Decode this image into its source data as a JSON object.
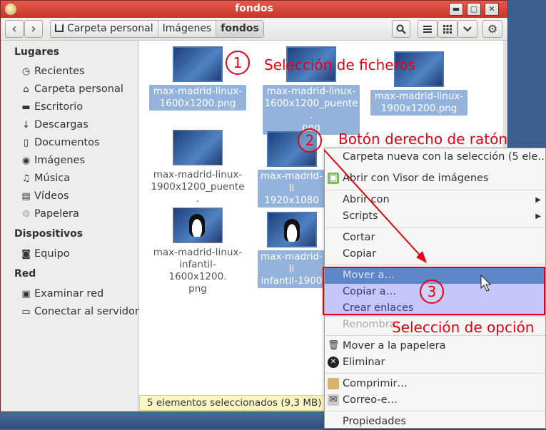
{
  "window": {
    "title": "fondos"
  },
  "titlebar": {
    "minimize": "▬",
    "maximize": "▢",
    "close": "✕"
  },
  "toolbar": {
    "back": "‹",
    "forward": "›",
    "breadcrumbs": [
      "Carpeta personal",
      "Imágenes",
      "fondos"
    ],
    "search_icon": "search-icon",
    "menu_icon": "list-icon",
    "grid_icon": "grid-icon",
    "chevron": "⌄",
    "gear": "⚙"
  },
  "sidebar": {
    "places_header": "Lugares",
    "places": [
      {
        "label": "Recientes",
        "icon": "◷"
      },
      {
        "label": "Carpeta personal",
        "icon": "⌂"
      },
      {
        "label": "Escritorio",
        "icon": "▬"
      },
      {
        "label": "Descargas",
        "icon": "↓"
      },
      {
        "label": "Documentos",
        "icon": "▯"
      },
      {
        "label": "Imágenes",
        "icon": "◉"
      },
      {
        "label": "Música",
        "icon": "♫"
      },
      {
        "label": "Vídeos",
        "icon": "▤"
      },
      {
        "label": "Papelera",
        "icon": "♲"
      }
    ],
    "devices_header": "Dispositivos",
    "devices": [
      {
        "label": "Equipo",
        "icon": "◙"
      }
    ],
    "network_header": "Red",
    "network": [
      {
        "label": "Examinar red",
        "icon": "▣"
      },
      {
        "label": "Conectar al servidor",
        "icon": "▭"
      }
    ]
  },
  "files": [
    {
      "name": "max-madrid-linux-1600x1200.png",
      "selected": true
    },
    {
      "name": "max-madrid-linux-1600x1200_puente.png",
      "selected": true
    },
    {
      "name": "max-madrid-linux-1900x1200.png",
      "selected": true
    },
    {
      "name": "max-madrid-linux-1900x1200_puente.png",
      "selected": false
    },
    {
      "name": "max-madrid-linux-1920x1080",
      "selected": true
    },
    {
      "name": "max-madrid-linux-infantil-1600x1200.png",
      "selected": false
    },
    {
      "name": "max-madrid-linux-infantil-1900",
      "selected": true
    }
  ],
  "file_lines": {
    "f0": [
      "max-madrid-linux-",
      "1600x1200.png"
    ],
    "f1": [
      "max-madrid-linux-",
      "1600x1200_puente.",
      "png"
    ],
    "f2": [
      "max-madrid-linux-",
      "1900x1200.png"
    ],
    "f3": [
      "max-madrid-linux-",
      "1900x1200_puente.",
      "png"
    ],
    "f4": [
      "max-madrid-li",
      "1920x1080"
    ],
    "f5": [
      "max-madrid-linux-",
      "infantil-1600x1200.",
      "png"
    ],
    "f6": [
      "max-madrid-li",
      "infantil-1900"
    ]
  },
  "status": {
    "text": "5 elementos seleccionados  (9,3 MB)"
  },
  "context_menu": {
    "items": {
      "new_folder": "Carpeta nueva con la selección (5 ele…",
      "open_with": "Abrir con Visor de imágenes",
      "open_with_sub": "Abrir con",
      "scripts": "Scripts",
      "cut": "Cortar",
      "copy": "Copiar",
      "move_to": "Mover a…",
      "copy_to": "Copiar a…",
      "make_links": "Crear enlaces",
      "rename": "Renombrar…",
      "trash": "Mover a la papelera",
      "delete": "Eliminar",
      "compress": "Comprimir…",
      "email": "Correo-e…",
      "properties": "Propiedades"
    }
  },
  "annotations": {
    "step1": "1",
    "label1": "Selección de ficheros",
    "step2": "2",
    "label2": "Botón derecho de ratón",
    "step3": "3",
    "label3": "Selección de opción",
    "color": "#e3000f"
  }
}
